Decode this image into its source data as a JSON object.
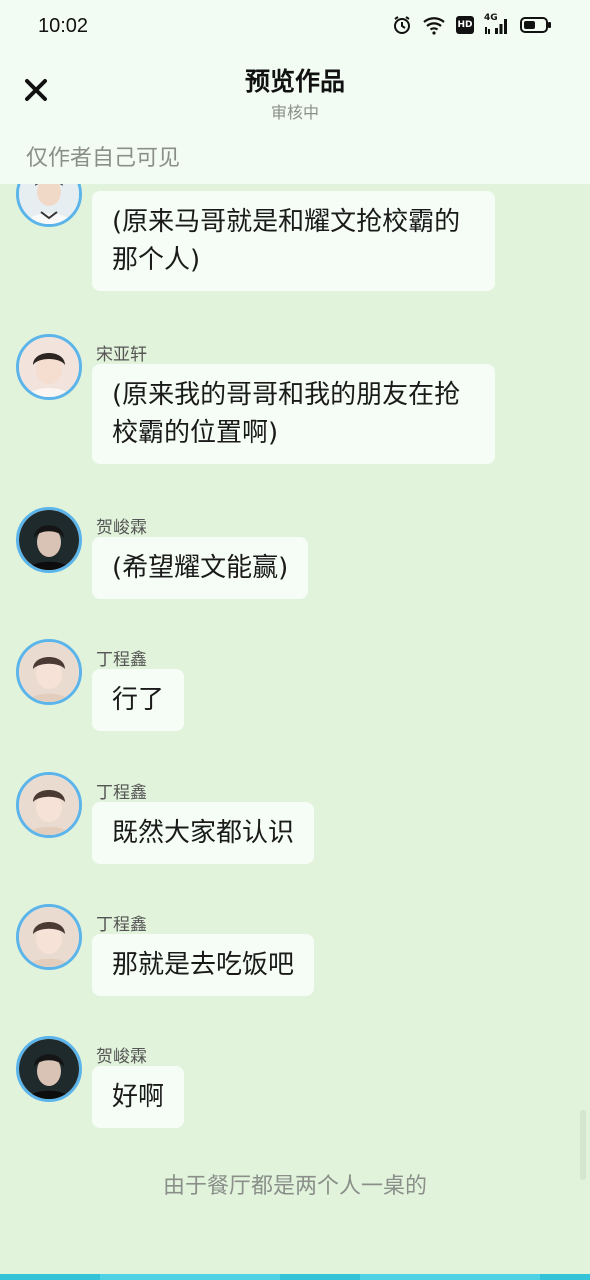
{
  "status_bar": {
    "time": "10:02",
    "network_label": "4G",
    "hd_label": "HD"
  },
  "header": {
    "title": "预览作品",
    "subtitle": "审核中"
  },
  "notice": {
    "text": "仅作者自己可见"
  },
  "messages": [
    {
      "name": "",
      "text": "(原来马哥就是和耀文抢校霸的那个人)",
      "avatar": "boy-white-shirt"
    },
    {
      "name": "宋亚轩",
      "text": "(原来我的哥哥和我的朋友在抢校霸的位置啊)",
      "avatar": "boy-pink-bg"
    },
    {
      "name": "贺峻霖",
      "text": "(希望耀文能赢)",
      "avatar": "boy-dark"
    },
    {
      "name": "丁程鑫",
      "text": "行了",
      "avatar": "boy-beige"
    },
    {
      "name": "丁程鑫",
      "text": "既然大家都认识",
      "avatar": "boy-beige"
    },
    {
      "name": "丁程鑫",
      "text": "那就是去吃饭吧",
      "avatar": "boy-beige"
    },
    {
      "name": "贺峻霖",
      "text": "好啊",
      "avatar": "boy-dark"
    }
  ],
  "narration": {
    "text": "由于餐厅都是两个人一桌的"
  },
  "colors": {
    "background": "#e2f3dc",
    "header_bg": "#f3fcf3",
    "bubble_bg": "#f6fdf6",
    "avatar_ring": "#5bb4ea",
    "bottom_accent": "#33c3d9"
  }
}
